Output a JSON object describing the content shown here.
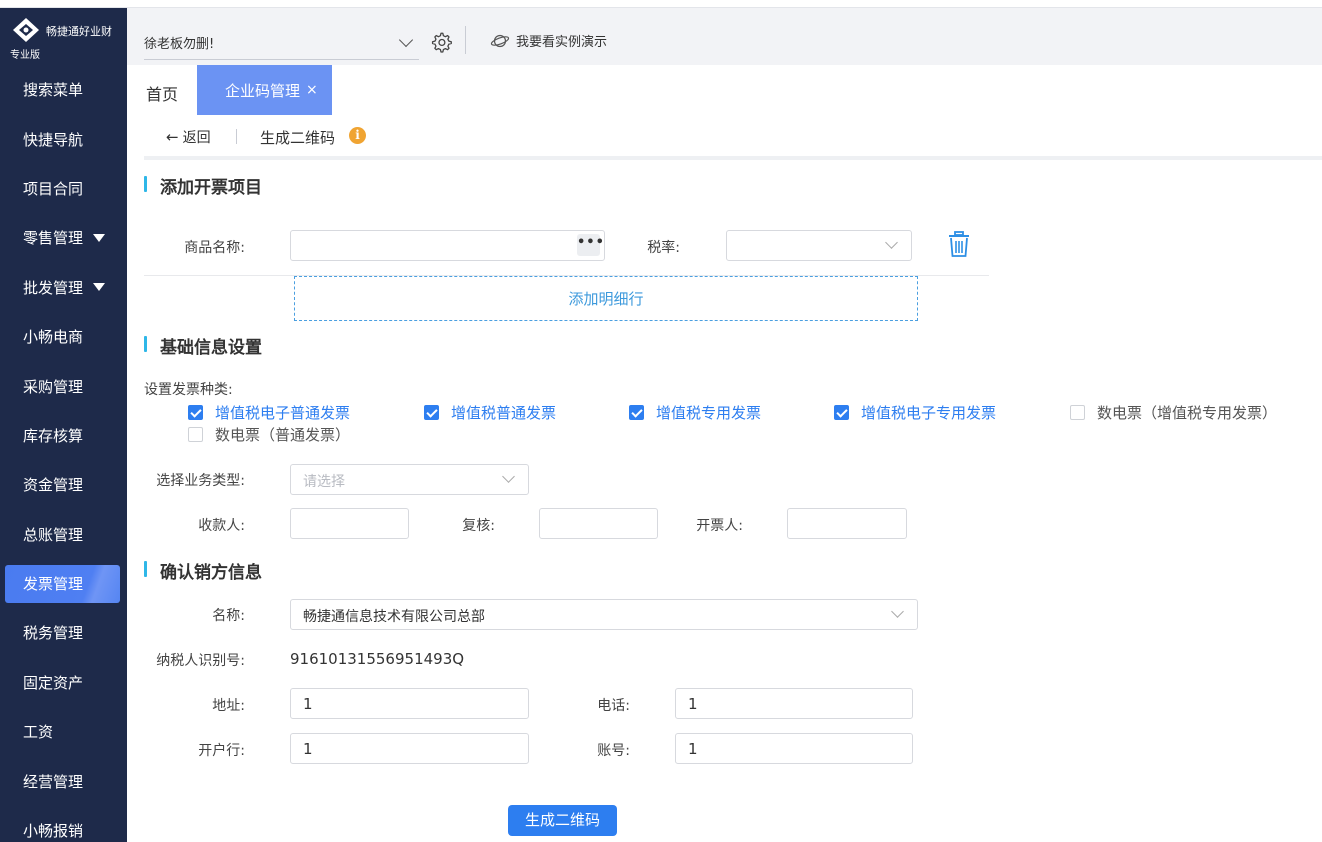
{
  "app": {
    "name": "畅捷通好业财",
    "edition": "专业版"
  },
  "sidebar": {
    "items": [
      {
        "label": "搜索菜单"
      },
      {
        "label": "快捷导航"
      },
      {
        "label": "项目合同"
      },
      {
        "label": "零售管理",
        "expandable": true
      },
      {
        "label": "批发管理",
        "expandable": true
      },
      {
        "label": "小畅电商"
      },
      {
        "label": "采购管理"
      },
      {
        "label": "库存核算"
      },
      {
        "label": "资金管理"
      },
      {
        "label": "总账管理"
      },
      {
        "label": "发票管理",
        "active": true
      },
      {
        "label": "税务管理"
      },
      {
        "label": "固定资产"
      },
      {
        "label": "工资"
      },
      {
        "label": "经营管理"
      },
      {
        "label": "小畅报销"
      }
    ]
  },
  "header": {
    "company_select": "徐老板勿删!",
    "settings_icon": "gear-icon",
    "demo_link": "我要看实例演示",
    "demo_icon": "planet-icon"
  },
  "tabs": {
    "home": "首页",
    "active": "企业码管理",
    "close": "×"
  },
  "breadcrumb": {
    "back": "返回",
    "back_arrow": "←",
    "title": "生成二维码",
    "info": "i"
  },
  "section_invoice_items": {
    "title": "添加开票项目",
    "product_name_label": "商品名称:",
    "product_name_value": "",
    "more_button": "•••",
    "tax_rate_label": "税率:",
    "tax_rate_value": "",
    "add_row": "添加明细行"
  },
  "section_basic": {
    "title": "基础信息设置",
    "invoice_type_label": "设置发票种类:",
    "invoice_types": [
      {
        "label": "增值税电子普通发票",
        "checked": true
      },
      {
        "label": "增值税普通发票",
        "checked": true
      },
      {
        "label": "增值税专用发票",
        "checked": true
      },
      {
        "label": "增值税电子专用发票",
        "checked": true
      },
      {
        "label": "数电票（增值税专用发票）",
        "checked": false
      },
      {
        "label": "数电票（普通发票）",
        "checked": false
      }
    ],
    "business_type_label": "选择业务类型:",
    "business_type_placeholder": "请选择",
    "payee_label": "收款人:",
    "payee_value": "",
    "reviewer_label": "复核:",
    "reviewer_value": "",
    "drawer_label": "开票人:",
    "drawer_value": ""
  },
  "section_seller": {
    "title": "确认销方信息",
    "name_label": "名称:",
    "name_value": "畅捷通信息技术有限公司总部",
    "tax_id_label": "纳税人识别号:",
    "tax_id_value": "91610131556951493Q",
    "address_label": "地址:",
    "address_value": "1",
    "phone_label": "电话:",
    "phone_value": "1",
    "bank_label": "开户行:",
    "bank_value": "1",
    "account_label": "账号:",
    "account_value": "1"
  },
  "actions": {
    "generate": "生成二维码"
  },
  "colors": {
    "sidebar_bg": "#1e2a4a",
    "primary": "#2d7ef0",
    "tab_active": "#6b93f3",
    "section_accent": "#2fb7e8",
    "info": "#f0a432"
  }
}
